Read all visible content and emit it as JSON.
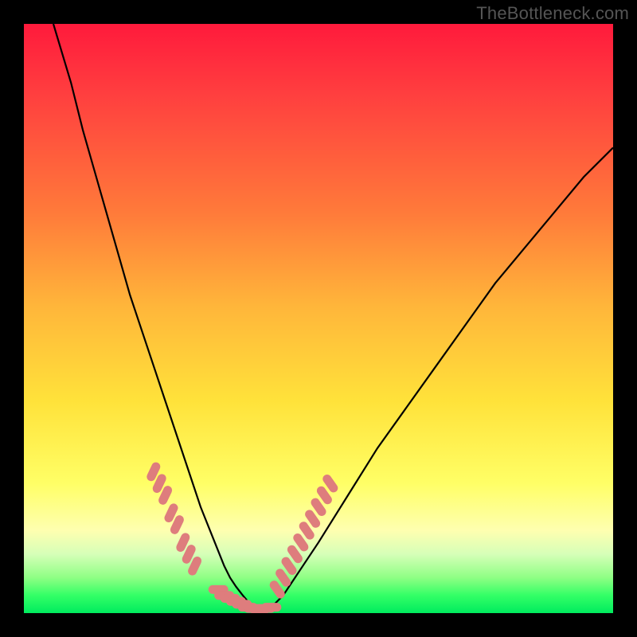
{
  "watermark": "TheBottleneck.com",
  "chart_data": {
    "type": "line",
    "title": "",
    "xlabel": "",
    "ylabel": "",
    "xlim": [
      0,
      100
    ],
    "ylim": [
      0,
      100
    ],
    "grid": false,
    "series": [
      {
        "name": "bottleneck-curve",
        "x": [
          5,
          8,
          10,
          12,
          14,
          16,
          18,
          20,
          22,
          24,
          26,
          28,
          30,
          32,
          34,
          35,
          36,
          37,
          38,
          39,
          40,
          41,
          42,
          44,
          46,
          50,
          55,
          60,
          65,
          70,
          75,
          80,
          85,
          90,
          95,
          100
        ],
        "y": [
          100,
          90,
          82,
          75,
          68,
          61,
          54,
          48,
          42,
          36,
          30,
          24,
          18,
          13,
          8,
          6,
          4.5,
          3.2,
          2,
          1,
          0.5,
          0.5,
          1,
          3,
          6,
          12,
          20,
          28,
          35,
          42,
          49,
          56,
          62,
          68,
          74,
          79
        ]
      }
    ],
    "marker_clusters": [
      {
        "name": "left-tail-markers",
        "color": "#de7d7d",
        "x": [
          22,
          23,
          24,
          25,
          26,
          27,
          28,
          29
        ],
        "y": [
          24,
          22,
          20,
          17,
          15,
          12,
          10,
          8
        ]
      },
      {
        "name": "valley-markers",
        "color": "#de7d7d",
        "x": [
          33,
          34,
          35,
          36,
          37,
          38,
          39,
          40,
          41,
          42
        ],
        "y": [
          4,
          3,
          2.5,
          2,
          1.5,
          1,
          0.8,
          0.6,
          0.8,
          1
        ]
      },
      {
        "name": "right-tail-markers",
        "color": "#de7d7d",
        "x": [
          43,
          44,
          45,
          46,
          47,
          48,
          49,
          50,
          51,
          52
        ],
        "y": [
          4,
          6,
          8,
          10,
          12,
          14,
          16,
          18,
          20,
          22
        ]
      }
    ],
    "colors": {
      "curve": "#000000",
      "marker": "#de7d7d",
      "background_top": "#ff1a3c",
      "background_bottom": "#00eb5e",
      "frame": "#000000"
    }
  }
}
